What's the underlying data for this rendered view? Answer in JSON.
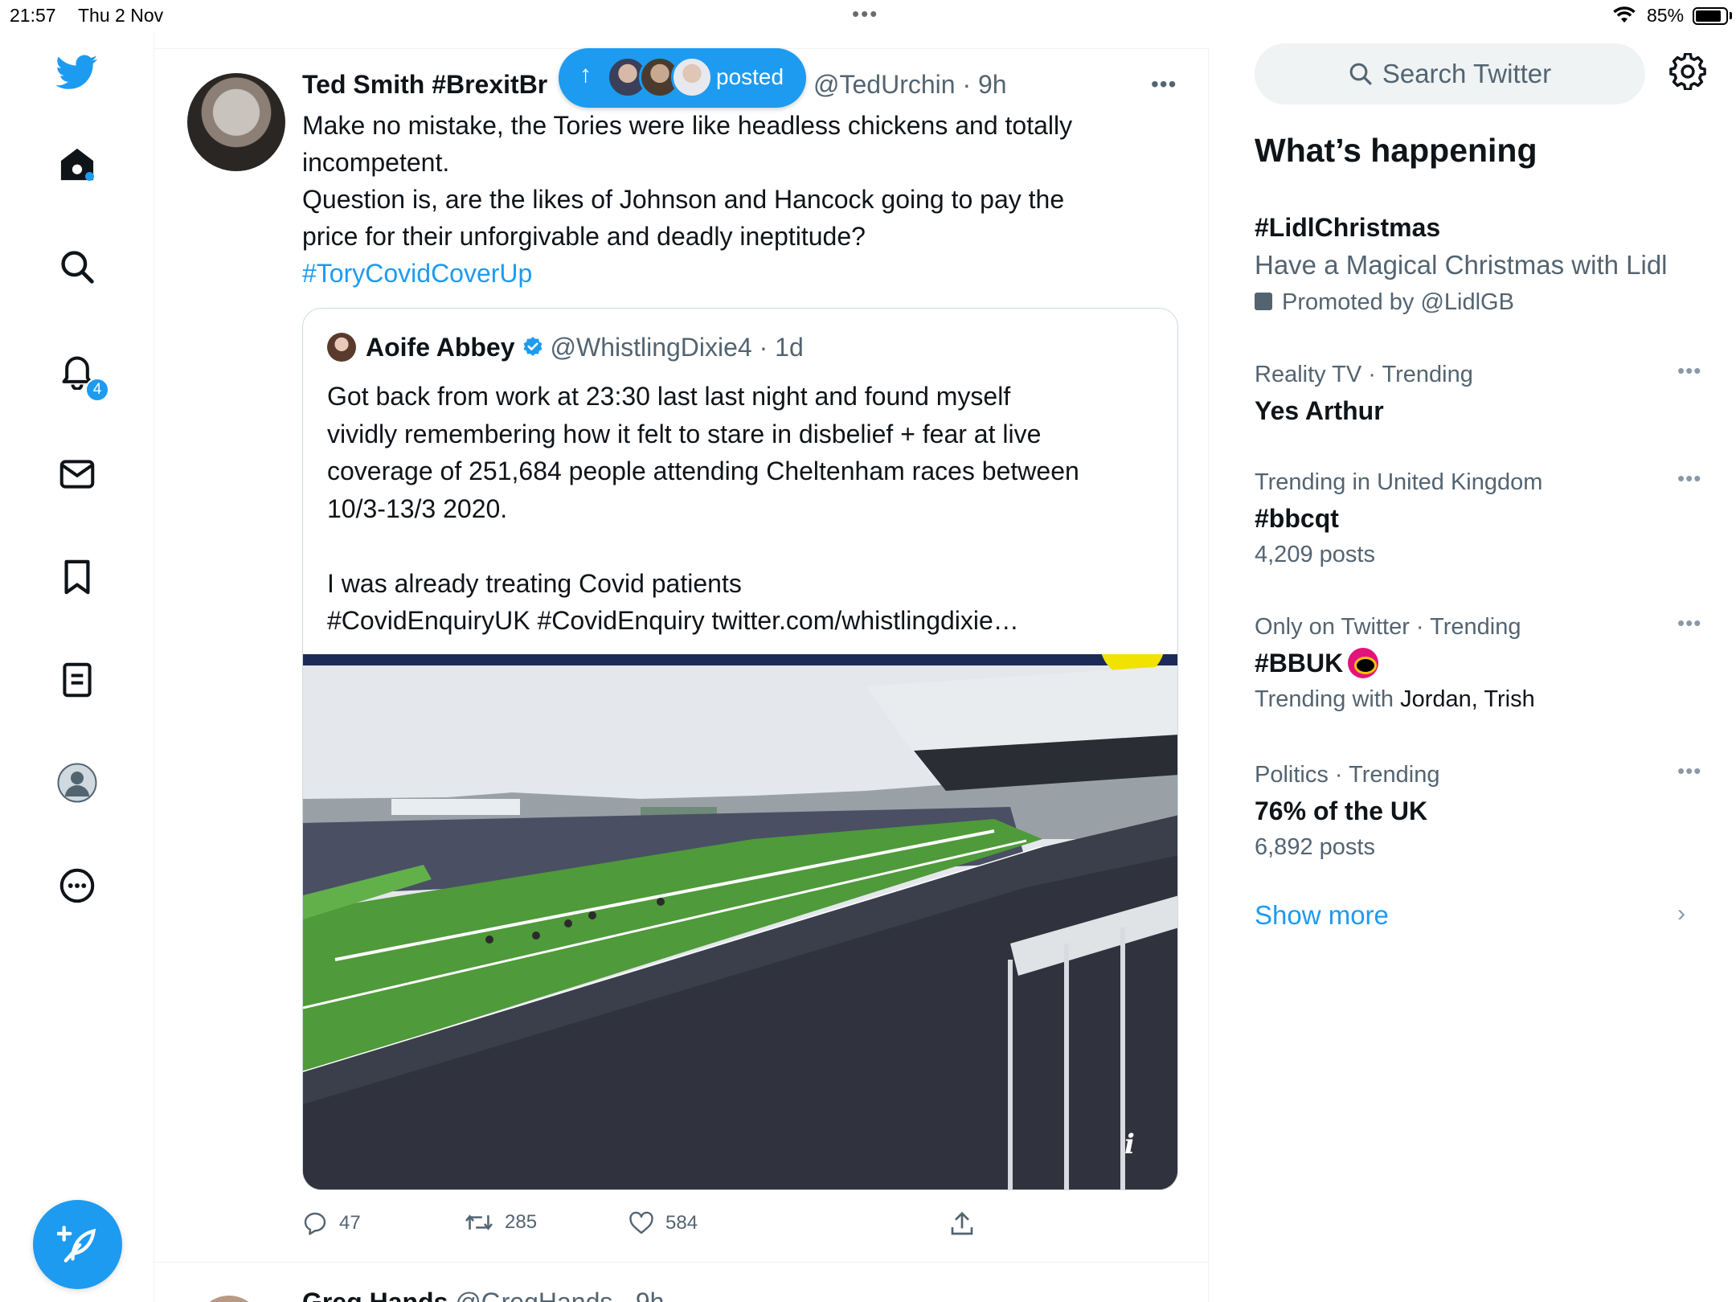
{
  "status_bar": {
    "time": "21:57",
    "date": "Thu 2 Nov",
    "battery_percent": "85%",
    "battery_level": 0.85,
    "icons": [
      "wifi-icon",
      "battery-icon"
    ]
  },
  "nav": {
    "items": [
      {
        "name": "twitter-logo-icon"
      },
      {
        "name": "home-icon"
      },
      {
        "name": "explore-search-icon"
      },
      {
        "name": "notifications-bell-icon"
      },
      {
        "name": "messages-envelope-icon"
      },
      {
        "name": "bookmarks-icon"
      },
      {
        "name": "lists-icon"
      },
      {
        "name": "profile-icon"
      },
      {
        "name": "more-options-icon"
      }
    ],
    "notification_count": "4",
    "compose_icon": "compose-feather-icon"
  },
  "colors": {
    "accent": "#1d9bf0",
    "text_primary": "#0f1419",
    "text_secondary": "#536471"
  },
  "new_posts_pill": {
    "label": "posted",
    "arrow": "↑"
  },
  "tweet": {
    "author_name": "Ted Smith #BrexitBr",
    "author_handle_time": "@TedUrchin · 9h",
    "text": "Make no mistake, the Tories were like headless chickens and totally\nincompetent.\nQuestion is, are the likes of Johnson and Hancock going to pay the\nprice for their unforgivable and deadly ineptitude?",
    "hashtag": "#ToryCovidCoverUp",
    "quote": {
      "name": "Aoife Abbey",
      "handle_time": "@WhistlingDixie4 · 1d",
      "text": "Got back from work at 23:30 last last night and found myself\nvividly remembering how it felt to stare in disbelief + fear at live\ncoverage of 251,684 people attending Cheltenham races between\n10/3-13/3 2020.\n\nI was already treating Covid patients\n#CovidEnquiryUK #CovidEnquiry twitter.com/whistlingdixie…",
      "media_info": "i"
    },
    "actions": {
      "replies": "47",
      "retweets": "285",
      "likes": "584"
    }
  },
  "next_tweet": {
    "author_name": "Greg Hands",
    "author_handle_time": "@GregHands · 9h"
  },
  "sidebar": {
    "search_placeholder": "Search Twitter",
    "section_title": "What’s happening",
    "promoted": {
      "title": "#LidlChristmas",
      "description": "Have a Magical Christmas with Lidl",
      "promoted_by": "Promoted by @LidlGB"
    },
    "trends": [
      {
        "meta": "Reality TV · Trending",
        "title": "Yes Arthur",
        "sub": ""
      },
      {
        "meta": "Trending in United Kingdom",
        "title": "#bbcqt",
        "sub": "4,209 posts"
      },
      {
        "meta": "Only on Twitter · Trending",
        "title": "#BBUK",
        "sub_prefix": "Trending with ",
        "sub_names": "Jordan, Trish"
      },
      {
        "meta": "Politics · Trending",
        "title": "76% of the UK",
        "sub": "6,892 posts"
      }
    ],
    "show_more": "Show more"
  }
}
